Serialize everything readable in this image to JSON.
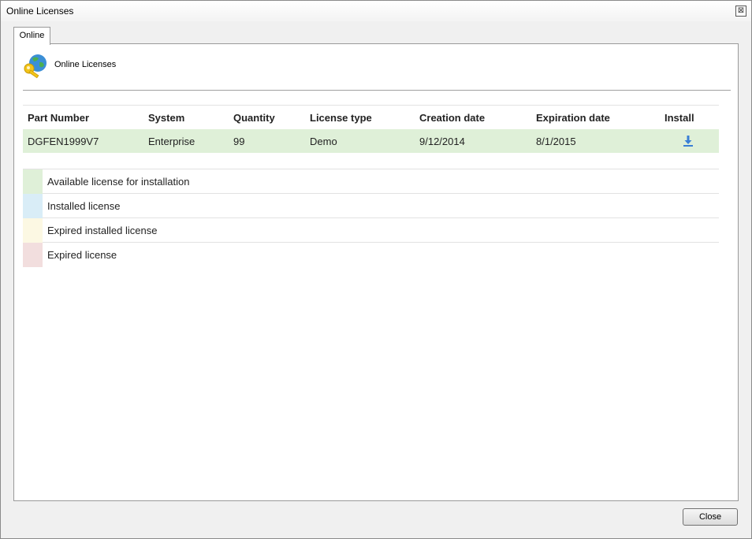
{
  "window": {
    "title": "Online Licenses",
    "close_glyph": "⊠"
  },
  "tabs": [
    {
      "label": "Online"
    }
  ],
  "header": {
    "title": "Online Licenses",
    "icon": "globe-key-icon"
  },
  "table": {
    "columns": [
      "Part Number",
      "System",
      "Quantity",
      "License type",
      "Creation date",
      "Expiration date",
      "Install"
    ],
    "rows": [
      {
        "part_number": "DGFEN1999V7",
        "system": "Enterprise",
        "quantity": "99",
        "license_type": "Demo",
        "creation_date": "9/12/2014",
        "expiration_date": "8/1/2015",
        "install_icon": "download-icon"
      }
    ]
  },
  "legend": [
    {
      "label": "Available license for installation",
      "color": "#dff0d8"
    },
    {
      "label": "Installed license",
      "color": "#d9edf7"
    },
    {
      "label": "Expired installed license",
      "color": "#fcf8e3"
    },
    {
      "label": "Expired license",
      "color": "#f2dede"
    }
  ],
  "footer": {
    "close_label": "Close"
  },
  "colors": {
    "accent": "#3a7fd5",
    "available_row": "#dff0d8"
  }
}
